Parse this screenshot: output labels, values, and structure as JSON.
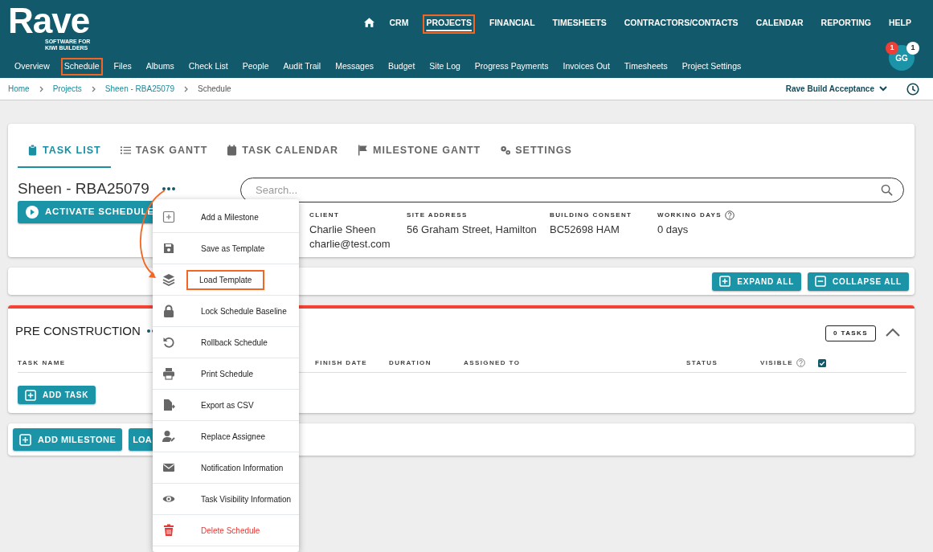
{
  "logo": {
    "name": "Rave",
    "tagline": "SOFTWARE FOR KIWI BUILDERS"
  },
  "top_nav": [
    {
      "label": "CRM",
      "selected": false,
      "highlighted": false
    },
    {
      "label": "PROJECTS",
      "selected": true,
      "highlighted": true
    },
    {
      "label": "FINANCIAL",
      "selected": false,
      "highlighted": false
    },
    {
      "label": "TIMESHEETS",
      "selected": false,
      "highlighted": false
    },
    {
      "label": "CONTRACTORS/CONTACTS",
      "selected": false,
      "highlighted": false
    },
    {
      "label": "CALENDAR",
      "selected": false,
      "highlighted": false
    },
    {
      "label": "REPORTING",
      "selected": false,
      "highlighted": false
    },
    {
      "label": "HELP",
      "selected": false,
      "highlighted": false
    }
  ],
  "avatar": {
    "initials": "GG",
    "badges": [
      {
        "count": "1",
        "color": "#ef3e36"
      },
      {
        "count": "1",
        "color": "#ffffff"
      }
    ]
  },
  "sub_nav": [
    {
      "label": "Overview",
      "highlighted": false
    },
    {
      "label": "Schedule",
      "highlighted": true
    },
    {
      "label": "Files",
      "highlighted": false
    },
    {
      "label": "Albums",
      "highlighted": false
    },
    {
      "label": "Check List",
      "highlighted": false
    },
    {
      "label": "People",
      "highlighted": false
    },
    {
      "label": "Audit Trail",
      "highlighted": false
    },
    {
      "label": "Messages",
      "highlighted": false
    },
    {
      "label": "Budget",
      "highlighted": false
    },
    {
      "label": "Site Log",
      "highlighted": false
    },
    {
      "label": "Progress Payments",
      "highlighted": false
    },
    {
      "label": "Invoices Out",
      "highlighted": false
    },
    {
      "label": "Timesheets",
      "highlighted": false
    },
    {
      "label": "Project Settings",
      "highlighted": false
    }
  ],
  "breadcrumb": [
    {
      "label": "Home",
      "link": true
    },
    {
      "label": "Projects",
      "link": true
    },
    {
      "label": "Sheen - RBA25079",
      "link": true
    },
    {
      "label": "Schedule",
      "link": false
    }
  ],
  "project_selector": "Rave Build Acceptance",
  "tabs": [
    {
      "label": "TASK LIST",
      "selected": true
    },
    {
      "label": "TASK GANTT",
      "selected": false
    },
    {
      "label": "TASK CALENDAR",
      "selected": false
    },
    {
      "label": "MILESTONE GANTT",
      "selected": false
    },
    {
      "label": "SETTINGS",
      "selected": false
    }
  ],
  "project_title": "Sheen - RBA25079",
  "activate_button": "ACTIVATE SCHEDULE",
  "search": {
    "placeholder": "Search..."
  },
  "info": [
    {
      "label": "CLIENT",
      "lines": [
        "Charlie Sheen",
        "charlie@test.com"
      ],
      "help": false
    },
    {
      "label": "SITE ADDRESS",
      "lines": [
        "56 Graham Street, Hamilton"
      ],
      "help": false
    },
    {
      "label": "BUILDING CONSENT",
      "lines": [
        "BC52698 HAM"
      ],
      "help": false
    },
    {
      "label": "WORKING DAYS",
      "lines": [
        "0 days"
      ],
      "help": true
    }
  ],
  "toolbar_buttons": [
    {
      "label": "EXPAND ALL",
      "kind": "expand"
    },
    {
      "label": "COLLAPSE ALL",
      "kind": "collapse"
    }
  ],
  "section": {
    "title": "PRE CONSTRUCTION",
    "task_count": "0 TASKS",
    "expanded": true,
    "columns": [
      {
        "label": "TASK NAME",
        "help": false
      },
      {
        "label": "FINISH DATE",
        "help": false
      },
      {
        "label": "DURATION",
        "help": false
      },
      {
        "label": "ASSIGNED TO",
        "help": false
      },
      {
        "label": "STATUS",
        "help": false
      },
      {
        "label": "VISIBLE",
        "help": true
      }
    ],
    "all_visible": true,
    "add_button": "ADD TASK"
  },
  "footer_buttons": [
    {
      "label": "ADD MILESTONE",
      "kind": "add"
    },
    {
      "label": "LOA",
      "kind": "plain"
    }
  ],
  "menu": [
    {
      "label": "Add a Milestone",
      "kind": "normal",
      "highlighted": false
    },
    {
      "label": "Save as Template",
      "kind": "normal",
      "highlighted": false
    },
    {
      "label": "Load Template",
      "kind": "normal",
      "highlighted": true
    },
    {
      "label": "Lock Schedule Baseline",
      "kind": "normal",
      "highlighted": false
    },
    {
      "label": "Rollback Schedule",
      "kind": "normal",
      "highlighted": false
    },
    {
      "label": "Print Schedule",
      "kind": "normal",
      "highlighted": false
    },
    {
      "label": "Export as CSV",
      "kind": "normal",
      "highlighted": false
    },
    {
      "label": "Replace Assignee",
      "kind": "normal",
      "highlighted": false
    },
    {
      "label": "Notification Information",
      "kind": "normal",
      "highlighted": false
    },
    {
      "label": "Task Visibility Information",
      "kind": "normal",
      "highlighted": false
    },
    {
      "label": "Delete Schedule",
      "kind": "danger",
      "highlighted": false
    }
  ]
}
